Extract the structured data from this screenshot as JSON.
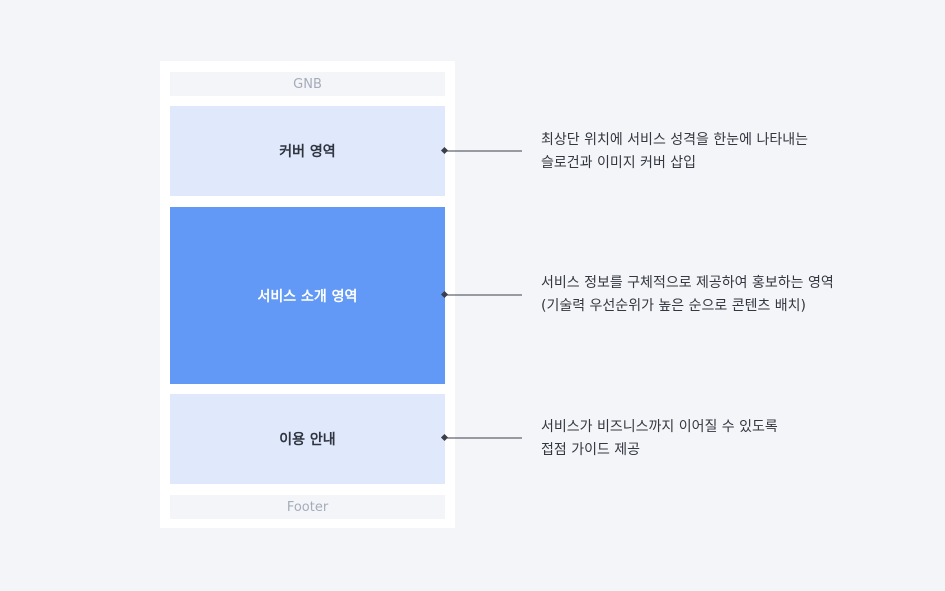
{
  "layout": {
    "gnb": "GNB",
    "cover": "커버 영역",
    "service": "서비스 소개 영역",
    "guide": "이용 안내",
    "footer": "Footer"
  },
  "descriptions": {
    "cover": [
      "최상단 위치에 서비스 성격을 한눈에 나타내는",
      "슬로건과 이미지 커버 삽입"
    ],
    "service": [
      "서비스 정보를 구체적으로 제공하여 홍보하는 영역",
      "(기술력 우선순위가 높은 순으로 콘텐츠 배치)"
    ],
    "guide": [
      "서비스가 비즈니스까지 이어질 수 있도록",
      "접점 가이드 제공"
    ]
  },
  "colors": {
    "background": "#f4f5f9",
    "section_light": "#dfe9fb",
    "section_accent": "#6299f6",
    "connector": "#3a3f4b"
  }
}
